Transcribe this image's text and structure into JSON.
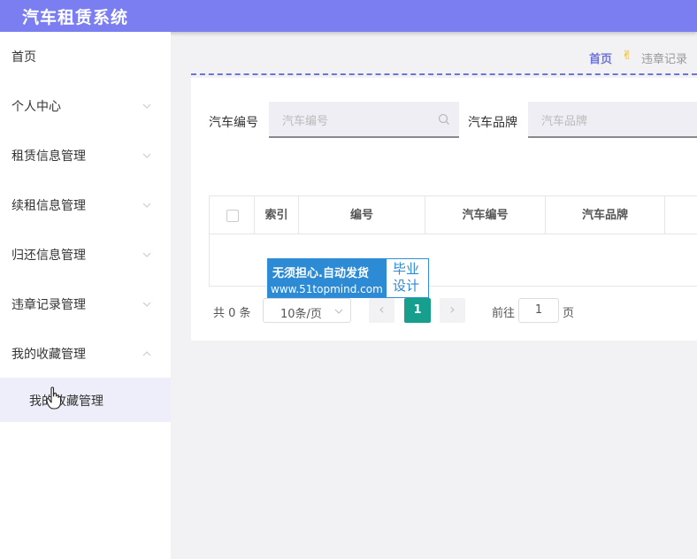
{
  "app": {
    "title": "汽车租赁系统"
  },
  "sidebar": {
    "items": [
      {
        "label": "首页"
      },
      {
        "label": "个人中心"
      },
      {
        "label": "租赁信息管理"
      },
      {
        "label": "续租信息管理"
      },
      {
        "label": "归还信息管理"
      },
      {
        "label": "违章记录管理"
      },
      {
        "label": "我的收藏管理"
      }
    ],
    "sub_item": {
      "label": "我的收藏管理"
    }
  },
  "breadcrumb": {
    "home": "首页",
    "current": "违章记录"
  },
  "search": {
    "field1": {
      "label": "汽车编号",
      "placeholder": "汽车编号"
    },
    "field2": {
      "label": "汽车品牌",
      "placeholder": "汽车品牌"
    }
  },
  "table": {
    "columns": [
      "索引",
      "编号",
      "汽车编号",
      "汽车品牌"
    ]
  },
  "watermark": {
    "line1": "无须担心.自动发货",
    "line2": "www.51topmind.com",
    "right_top": "毕业",
    "right_bottom": "设计"
  },
  "pagination": {
    "total": "共 0 条",
    "page_size": "10条/页",
    "current_page": "1",
    "goto_label": "前往",
    "goto_value": "1",
    "goto_suffix": "页"
  },
  "colors": {
    "header": "#7a7ef0",
    "accent": "#6e73d9",
    "pager_active": "#179f8d",
    "watermark": "#2d8ad4"
  }
}
